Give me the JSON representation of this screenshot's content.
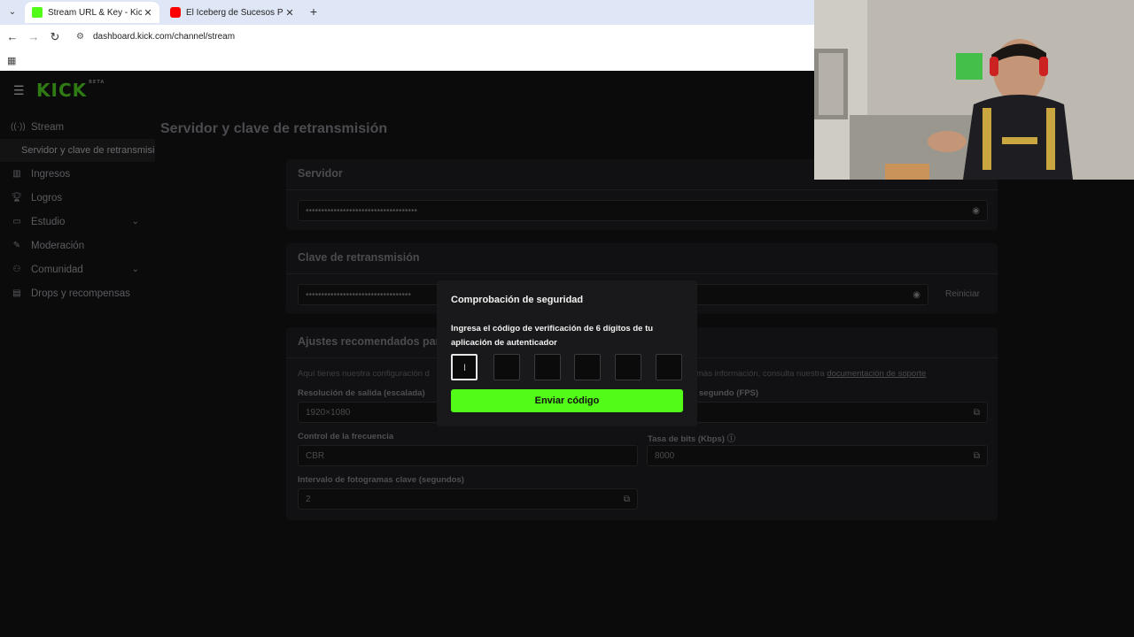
{
  "browser": {
    "tabs": [
      {
        "title": "Stream URL & Key - Kick Dashb",
        "active": true,
        "favicon_color": "#53fc18"
      },
      {
        "title": "El Iceberg de Sucesos Paranorm",
        "active": false,
        "favicon_color": "#ff0000"
      }
    ],
    "url": "dashboard.kick.com/channel/stream"
  },
  "app": {
    "logo": "KICK",
    "logo_badge": "BETA"
  },
  "sidebar": {
    "items": [
      {
        "label": "Stream",
        "icon": "broadcast-icon"
      },
      {
        "label": "Servidor y clave de retransmisión",
        "sub": true
      },
      {
        "label": "Ingresos",
        "icon": "chart-icon"
      },
      {
        "label": "Logros",
        "icon": "trophy-icon"
      },
      {
        "label": "Estudio",
        "icon": "studio-icon",
        "expandable": true
      },
      {
        "label": "Moderación",
        "icon": "wrench-icon"
      },
      {
        "label": "Comunidad",
        "icon": "community-icon",
        "expandable": true
      },
      {
        "label": "Drops y recompensas",
        "icon": "gift-icon"
      }
    ]
  },
  "main": {
    "title": "Servidor y clave de retransmisión",
    "server": {
      "title": "Servidor",
      "value": "••••••••••••••••••••••••••••••••••••"
    },
    "key": {
      "title": "Clave de retransmisión",
      "value": "••••••••••••••••••••••••••••••••••",
      "reset_label": "Reiniciar"
    },
    "recommended": {
      "title": "Ajustes recomendados par",
      "description_start": "Aquí tienes nuestra configuración d",
      "description_end": "más información, consulta nuestra ",
      "doc_link": "documentación de soporte",
      "fields": {
        "resolution": {
          "label": "Resolución de salida (escalada)",
          "value": "1920×1080"
        },
        "fps": {
          "label": "segundo (FPS)",
          "value": ""
        },
        "rate_control": {
          "label": "Control de la frecuencia",
          "value": "CBR"
        },
        "bitrate": {
          "label": "Tasa de bits (Kbps)",
          "value": "8000"
        },
        "keyframe": {
          "label": "Intervalo de fotogramas clave (segundos)",
          "value": "2"
        }
      }
    }
  },
  "modal": {
    "title": "Comprobación de seguridad",
    "text": "Ingresa el código de verificación de 6 dígitos de tu aplicación de autenticador",
    "digits": [
      "",
      "",
      "",
      "",
      "",
      ""
    ],
    "submit_label": "Enviar código"
  },
  "colors": {
    "accent": "#53fc18",
    "background": "#0b0b0c",
    "modal": "#19191b"
  }
}
